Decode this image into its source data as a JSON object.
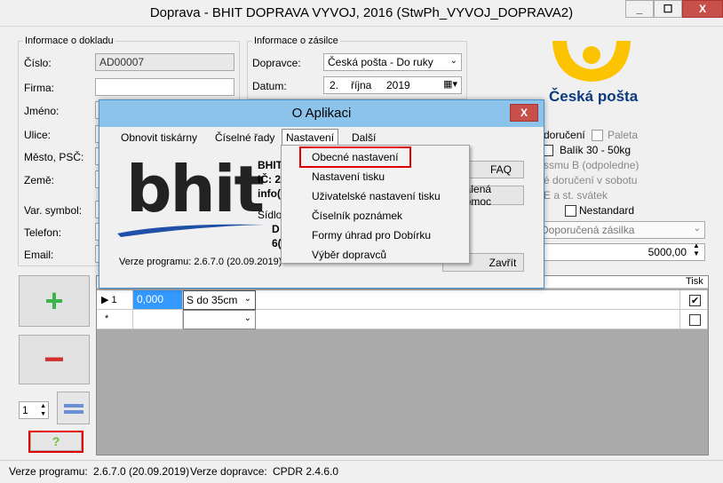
{
  "window": {
    "title": "Doprava - BHIT DOPRAVA VYVOJ, 2016 (StwPh_VYVOJ_DOPRAVA2)",
    "min": "_",
    "max": "☐",
    "close": "X"
  },
  "doklad": {
    "group_title": "Informace o dokladu",
    "cislo_label": "Číslo:",
    "cislo_value": "AD00007",
    "firma_label": "Firma:",
    "jmeno_label": "Jméno:",
    "ulice_label": "Ulice:",
    "mesto_label": "Město, PSČ:",
    "zeme_label": "Země:",
    "varsym_label": "Var. symbol:",
    "telefon_label": "Telefon:",
    "email_label": "Email:"
  },
  "zasilka": {
    "group_title": "Informace o zásilce",
    "dopravce_label": "Dopravce:",
    "dopravce_value": "Česká pošta - Do ruky",
    "datum_label": "Datum:",
    "datum_day": "2.",
    "datum_month": "října",
    "datum_year": "2019"
  },
  "logo": {
    "text": "Česká pošta",
    "brand_color": "#fcc300",
    "text_color": "#0b3a7e"
  },
  "options": {
    "doruceni": "doručení",
    "paleta": "Paleta",
    "balik": "Balík 30 - 50kg",
    "ssmu": "ssmu B (odpoledne)",
    "sobota": "é doručení v sobotu",
    "svatek": "E a st. svátek",
    "nestandard": "Nestandard",
    "service_select": "Doporučená zásilka",
    "amount": "5000,00"
  },
  "grid": {
    "header_tisk": "Tisk",
    "rows": [
      {
        "marker": "▶ 1",
        "value": "0,000",
        "size": "S do 35cm",
        "tisk": true
      },
      {
        "marker": "*",
        "value": "",
        "size": "",
        "tisk": false
      }
    ]
  },
  "side": {
    "plus": "+",
    "minus": "−",
    "copies": "1",
    "help": "?"
  },
  "dialog": {
    "title": "O Aplikaci",
    "close": "X",
    "menu": {
      "obnovit": "Obnovit tiskárny",
      "ciselne": "Číselné řady",
      "nastaveni": "Nastavení",
      "dalsi": "Další"
    },
    "bhit_logo": "bhit",
    "info1": "BHIT",
    "info2": "IČ: 2",
    "info3": "info(",
    "sidlo": "Sídlo",
    "d": "D",
    "six": "6(",
    "faq": "FAQ",
    "pomoc": "dálená pomoc",
    "zavrit": "Zavřít",
    "verze": "Verze programu: 2.6.7.0 (20.09.2019)"
  },
  "dropdown": {
    "items": [
      "Obecné nastavení",
      "Nastavení tisku",
      "Uživatelské nastavení tisku",
      "Číselník poznámek",
      "Formy úhrad pro Dobírku",
      "Výběr dopravců"
    ]
  },
  "status": {
    "verze_label": "Verze programu:",
    "verze_value": "2.6.7.0 (20.09.2019)",
    "dopravce_label": "Verze dopravce:",
    "dopravce_value": "CPDR 2.4.6.0"
  }
}
